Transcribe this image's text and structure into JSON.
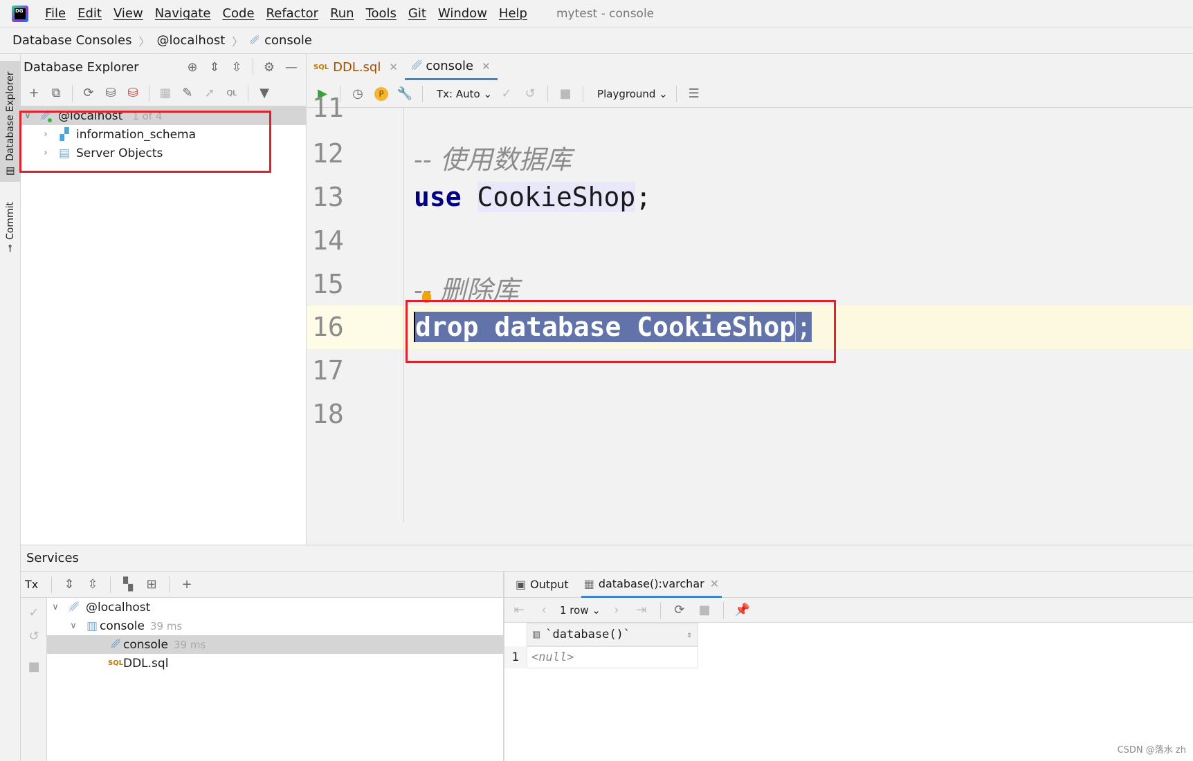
{
  "app": {
    "window_title": "mytest - console",
    "logo_text": "DG",
    "menu": [
      "File",
      "Edit",
      "View",
      "Navigate",
      "Code",
      "Refactor",
      "Run",
      "Tools",
      "Git",
      "Window",
      "Help"
    ]
  },
  "breadcrumb": [
    "Database Consoles",
    "@localhost",
    "console"
  ],
  "side_tabs": {
    "database_explorer": "Database Explorer",
    "commit": "Commit"
  },
  "explorer": {
    "title": "Database Explorer",
    "tree": [
      {
        "label": "@localhost",
        "note": "1 of 4"
      },
      {
        "label": "information_schema"
      },
      {
        "label": "Server Objects"
      }
    ]
  },
  "editor": {
    "tabs": [
      {
        "label": "DDL.sql",
        "icon": "sql-file-icon"
      },
      {
        "label": "console",
        "icon": "mysql-console-icon",
        "active": true
      }
    ],
    "toolbar": {
      "tx_mode": "Tx: Auto",
      "playground": "Playground",
      "p_badge": "P"
    },
    "line_numbers": [
      "11",
      "12",
      "13",
      "14",
      "15",
      "16",
      "17",
      "18"
    ],
    "code": {
      "line12": "-- 使用数据库",
      "line13_kw": "use",
      "line13_name": "CookieShop",
      "line13_end": ";",
      "line15": "-- 删除库",
      "line16_selected": "drop database CookieShop",
      "line16_end": ";"
    },
    "current_line": 16
  },
  "services": {
    "title": "Services",
    "tx_label": "Tx",
    "tree": [
      {
        "label": "@localhost"
      },
      {
        "label": "console",
        "time": "39 ms"
      },
      {
        "label": "console",
        "time": "39 ms"
      },
      {
        "label": "DDL.sql"
      }
    ],
    "result_tabs": [
      "Output",
      "database():varchar"
    ],
    "rows_label": "1 row",
    "grid": {
      "column": "`database()`",
      "row_number": "1",
      "value": "<null>"
    }
  },
  "watermark": "CSDN @落水 zh",
  "colors": {
    "selection": "#6173a8",
    "highlight_box": "#e0202a",
    "current_line": "#fdf9e1",
    "keyword": "#000080",
    "active_tab": "#4083c9"
  }
}
